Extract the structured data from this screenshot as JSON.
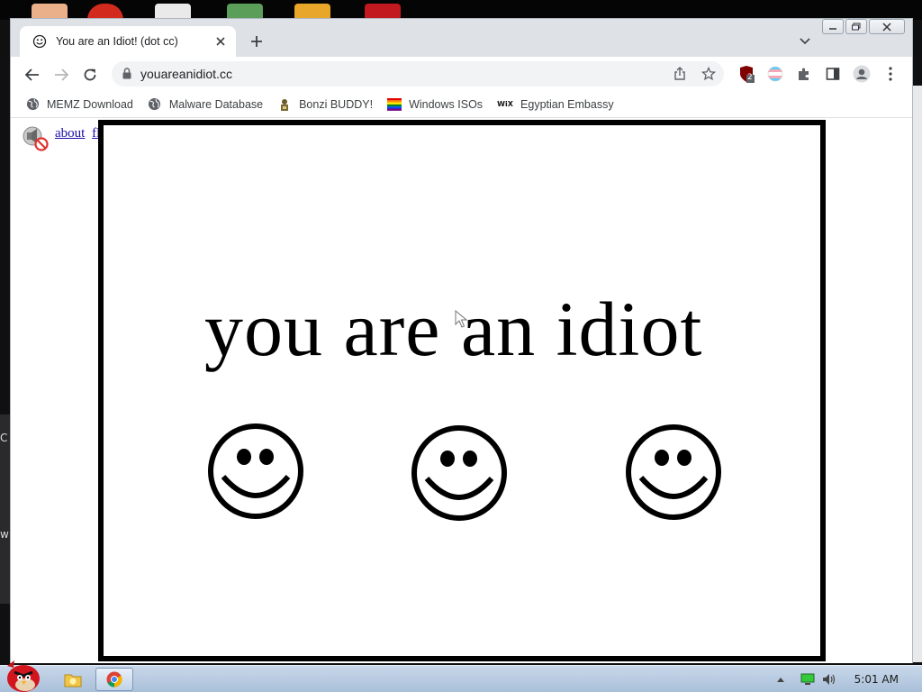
{
  "browser": {
    "tab": {
      "title": "You are an Idiot! (dot cc)"
    },
    "url": "youareanidiot.cc",
    "extension_badge": "2",
    "bookmarks": [
      {
        "label": "MEMZ Download",
        "icon": "globe-icon"
      },
      {
        "label": "Malware Database",
        "icon": "globe-icon"
      },
      {
        "label": "Bonzi BUDDY!",
        "icon": "bonzi-icon"
      },
      {
        "label": "Windows ISOs",
        "icon": "rainbow-flag-icon"
      },
      {
        "label": "Egyptian Embassy",
        "icon": "wix-icon"
      }
    ],
    "wix_glyph": "WiX"
  },
  "page": {
    "links": [
      "about",
      "flash"
    ],
    "headline": "you are an idiot",
    "smileys": [
      "smiley-face",
      "smiley-face",
      "smiley-face"
    ]
  },
  "taskbar": {
    "clock": "5:01 AM"
  },
  "desktop": {
    "left_edge_letters": [
      "C",
      "w"
    ]
  },
  "colors": {
    "tabbar": "#dee1e6",
    "link": "#1a0dab",
    "taskbar": "#b9cbe2"
  }
}
